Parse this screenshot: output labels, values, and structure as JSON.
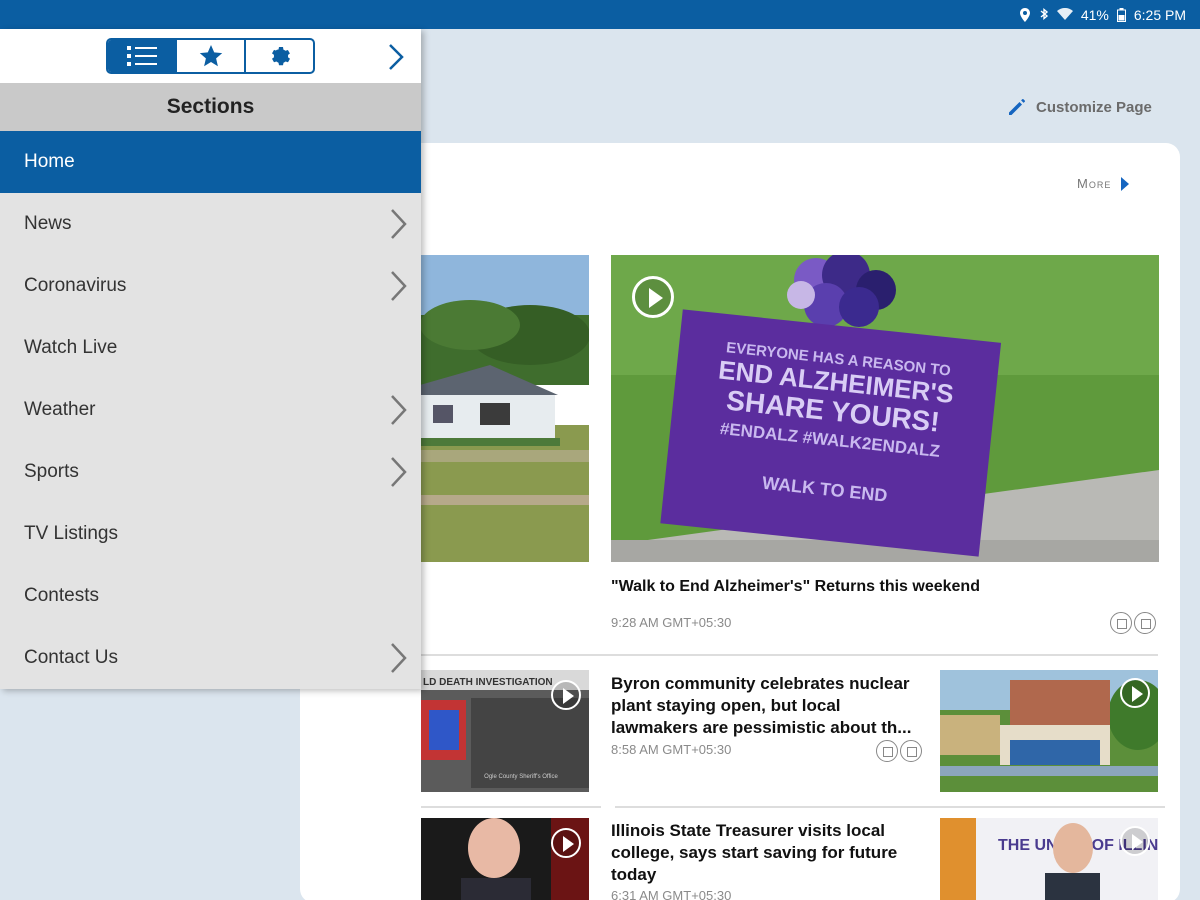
{
  "status_bar": {
    "battery": "41%",
    "time": "6:25 PM",
    "icons": [
      "location-icon",
      "bluetooth-icon",
      "wifi-icon",
      "battery-icon"
    ]
  },
  "page": {
    "customize_label": "Customize Page",
    "more_label": "More"
  },
  "stories": {
    "featured": {
      "headline": "\"Walk to End Alzheimer's\" Returns this weekend",
      "time": "9:28 AM GMT+05:30",
      "sign_text": [
        "EVERYONE HAS A REASON TO",
        "END ALZHEIMER'S",
        "SHARE YOURS!",
        "#ENDALZ  #WALK2ENDALZ"
      ],
      "logo_text": "WALK TO END"
    },
    "story2": {
      "headline": "Byron community celebrates nuclear plant staying open, but local lawmakers are pessimistic about th...",
      "time": "8:58 AM GMT+05:30",
      "left_banner_text": "LD DEATH INVESTIGATION",
      "left_caption": "Ogle County Sheriff's Office"
    },
    "story3": {
      "headline": "Illinois State Treasurer visits local college, says start saving for future today",
      "time": "6:31 AM GMT+05:30",
      "right_text": "THE UNIV  Y OF ILLIN  COLLE"
    }
  },
  "drawer": {
    "header": "Sections",
    "tabs": [
      {
        "name": "sections-tab",
        "icon": "list-icon",
        "active": true
      },
      {
        "name": "favorites-tab",
        "icon": "star-icon",
        "active": false
      },
      {
        "name": "settings-tab",
        "icon": "gear-icon",
        "active": false
      }
    ],
    "items": [
      {
        "label": "Home",
        "chevron": false,
        "active": true
      },
      {
        "label": "News",
        "chevron": true,
        "active": false
      },
      {
        "label": "Coronavirus",
        "chevron": true,
        "active": false
      },
      {
        "label": "Watch Live",
        "chevron": false,
        "active": false
      },
      {
        "label": "Weather",
        "chevron": true,
        "active": false
      },
      {
        "label": "Sports",
        "chevron": true,
        "active": false
      },
      {
        "label": "TV Listings",
        "chevron": false,
        "active": false
      },
      {
        "label": "Contests",
        "chevron": false,
        "active": false
      },
      {
        "label": "Contact Us",
        "chevron": true,
        "active": false
      }
    ]
  },
  "colors": {
    "brand": "#0b5ea2",
    "drawer_bg": "#e3e3e3",
    "page_bg": "#dbe5ee",
    "sign_purple": "#5b2d9e"
  }
}
